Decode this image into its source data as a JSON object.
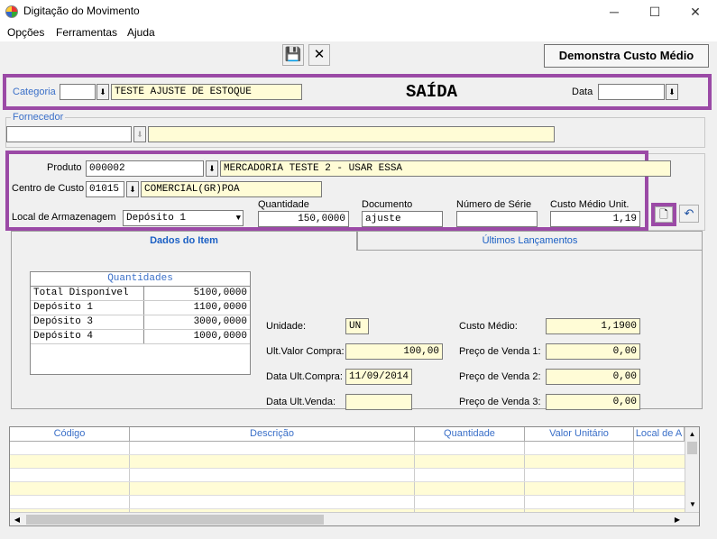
{
  "window": {
    "title": "Digitação do Movimento",
    "minimize": "─",
    "maximize": "☐",
    "close": "✕"
  },
  "menu": [
    "Opções",
    "Ferramentas",
    "Ajuda"
  ],
  "toolbar": {
    "save_icon": "💾",
    "cancel_icon": "✕",
    "demonstra_label": "Demonstra Custo Médio"
  },
  "header": {
    "categoria_label": "Categoria",
    "categoria_code": "",
    "categoria_desc": "TESTE AJUSTE DE ESTOQUE",
    "tipo": "SAÍDA",
    "data_label": "Data",
    "data_value": ""
  },
  "fornecedor": {
    "label": "Fornecedor",
    "code": "",
    "desc": ""
  },
  "item": {
    "produto_label": "Produto",
    "produto_code": "000002",
    "produto_desc": "MERCADORIA TESTE 2 - USAR ESSA",
    "centro_label": "Centro de Custo",
    "centro_code": "01015",
    "centro_desc": "COMERCIAL(GR)POA",
    "local_label": "Local de Armazenagem",
    "local_value": "Depósito 1",
    "quantidade_label": "Quantidade",
    "quantidade_value": "150,0000",
    "documento_label": "Documento",
    "documento_value": "ajuste",
    "serie_label": "Número de Série",
    "serie_value": "",
    "custo_label": "Custo Médio Unit.",
    "custo_value": "1,19"
  },
  "tabs": {
    "dados": "Dados do Item",
    "ultimos": "Últimos Lançamentos"
  },
  "quantidades": {
    "title": "Quantidades",
    "rows": [
      {
        "label": "Total Disponível",
        "value": "5100,0000"
      },
      {
        "label": "Depósito 1",
        "value": "1100,0000"
      },
      {
        "label": "Depósito 3",
        "value": "3000,0000"
      },
      {
        "label": "Depósito 4",
        "value": "1000,0000"
      }
    ]
  },
  "details": {
    "unidade_label": "Unidade:",
    "unidade_value": "UN",
    "ultvalor_label": "Ult.Valor Compra:",
    "ultvalor_value": "100,00",
    "dataultcompra_label": "Data Ult.Compra:",
    "dataultcompra_value": "11/09/2014",
    "dataultvenda_label": "Data Ult.Venda:",
    "dataultvenda_value": "",
    "customedio_label": "Custo Médio:",
    "customedio_value": "1,1900",
    "preco1_label": "Preço de Venda 1:",
    "preco1_value": "0,00",
    "preco2_label": "Preço de Venda 2:",
    "preco2_value": "0,00",
    "preco3_label": "Preço de Venda 3:",
    "preco3_value": "0,00"
  },
  "grid": {
    "columns": [
      "Código",
      "Descrição",
      "Quantidade",
      "Valor Unitário",
      "Local de A"
    ]
  },
  "colors": {
    "highlight_border": "#9b4aa6",
    "field_yellow": "#fffcd6",
    "label_blue": "#3a6fc8"
  }
}
